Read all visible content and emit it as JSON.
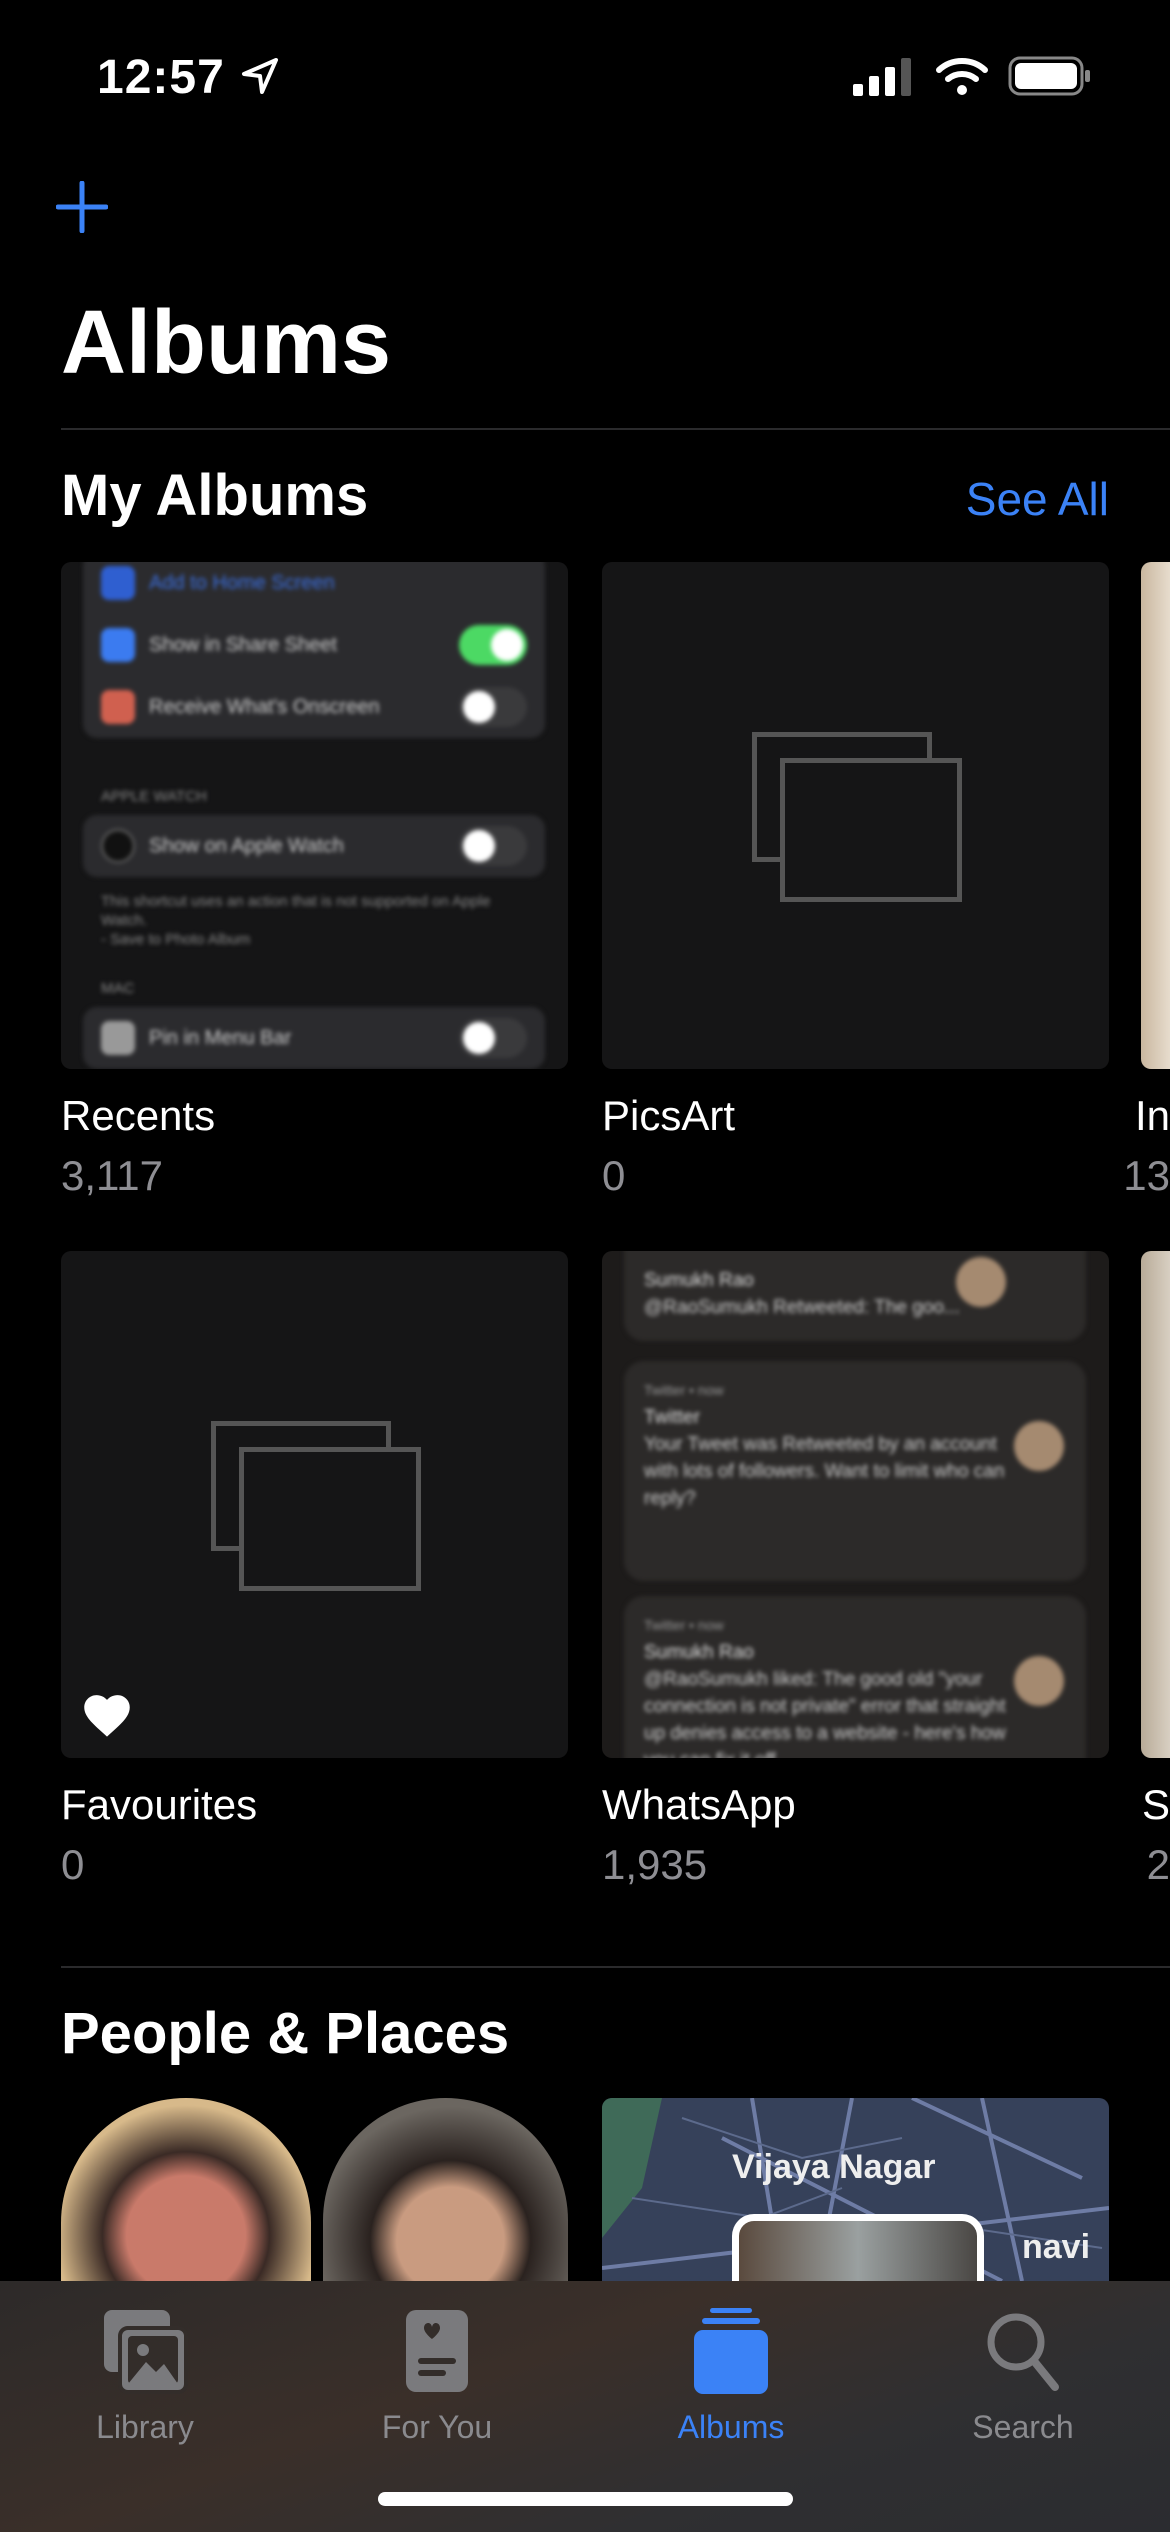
{
  "status": {
    "time": "12:57"
  },
  "header": {
    "title": "Albums",
    "add_icon": "plus-icon"
  },
  "my_albums": {
    "title": "My Albums",
    "see_all": "See All",
    "albums": [
      {
        "name": "Recents",
        "count": "3,117"
      },
      {
        "name": "PicsArt",
        "count": "0"
      },
      {
        "name": "In",
        "count": "13"
      },
      {
        "name": "Favourites",
        "count": "0"
      },
      {
        "name": "WhatsApp",
        "count": "1,935"
      },
      {
        "name": "S",
        "count": "2"
      }
    ]
  },
  "recents_thumb": {
    "rows": [
      "Add to Home Screen",
      "Show in Share Sheet",
      "Receive What's Onscreen",
      "APPLE WATCH",
      "Show on Apple Watch",
      "This shortcut uses an action that is not supported on Apple Watch.",
      "- Save to Photo Album",
      "MAC",
      "Pin in Menu Bar"
    ]
  },
  "whatsapp_thumb": {
    "n1_name": "Sumukh Rao",
    "n1_text": "@RaoSumukh Retweeted: The goo...",
    "n2_app": "Twitter • now",
    "n2_title": "Twitter",
    "n2_text": "Your Tweet was Retweeted by an account with lots of followers. Want to limit who can reply?",
    "n3_app": "Twitter • now",
    "n3_title": "Sumukh Rao",
    "n3_text": "@RaoSumukh liked: The good old \"your connection is not private\" error that straight up denies access to a website - here's how you can fix it off"
  },
  "people_places": {
    "title": "People & Places",
    "map_label": "Vijaya Nagar",
    "map_label2": "navi"
  },
  "tabs": [
    {
      "label": "Library"
    },
    {
      "label": "For You"
    },
    {
      "label": "Albums",
      "active": true
    },
    {
      "label": "Search"
    }
  ],
  "colors": {
    "accent": "#3b82f6",
    "inactive": "#8a8a8e"
  }
}
